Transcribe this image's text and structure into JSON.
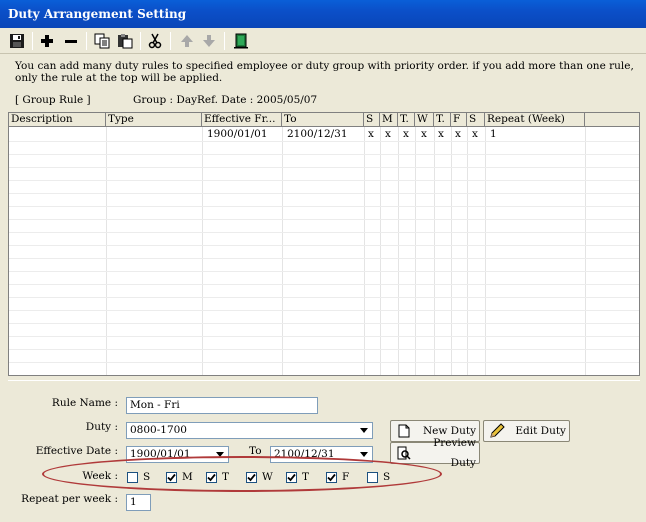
{
  "window": {
    "title": "Duty Arrangement Setting"
  },
  "toolbar": {
    "icons": [
      "save-icon",
      "add-icon",
      "remove-icon",
      "copy-icon",
      "paste-icon",
      "cut-icon",
      "move-up-icon",
      "move-down-icon",
      "exit-icon"
    ]
  },
  "description": "You can add many duty rules to specified employee or duty group with priority order. if you add more than one rule, only the rule at the top will be applied.",
  "info": {
    "rule_type": "[ Group Rule ]",
    "group": "Group : Day",
    "ref_date": "Ref. Date : 2005/05/07"
  },
  "grid": {
    "columns": [
      "Description",
      "Type",
      "Effective Fr...",
      "To",
      "S",
      "M",
      "T.",
      "W",
      "T.",
      "F",
      "S",
      "Repeat (Week)"
    ],
    "rows": [
      [
        "",
        "",
        "1900/01/01",
        "2100/12/31",
        "x",
        "x",
        "x",
        "x",
        "x",
        "x",
        "x",
        "1"
      ]
    ]
  },
  "form": {
    "rule_name_label": "Rule Name :",
    "rule_name_value": "Mon - Fri",
    "duty_label": "Duty :",
    "duty_value": "0800-1700",
    "effective_date_label": "Effective Date :",
    "effective_from_value": "1900/01/01",
    "to_label": "To",
    "effective_to_value": "2100/12/31",
    "week_label": "Week :",
    "week_days": [
      {
        "label": "S",
        "checked": false
      },
      {
        "label": "M",
        "checked": true
      },
      {
        "label": "T",
        "checked": true
      },
      {
        "label": "W",
        "checked": true
      },
      {
        "label": "T",
        "checked": true
      },
      {
        "label": "F",
        "checked": true
      },
      {
        "label": "S",
        "checked": false
      }
    ],
    "repeat_label": "Repeat per week :",
    "repeat_value": "1",
    "new_duty_label": "New Duty",
    "edit_duty_label": "Edit Duty",
    "preview_duty_label": "Preview Duty"
  },
  "colors": {
    "title_bar": "#0b4fc8",
    "annotation_oval": "#b03a3a",
    "background": "#ece9d8"
  }
}
